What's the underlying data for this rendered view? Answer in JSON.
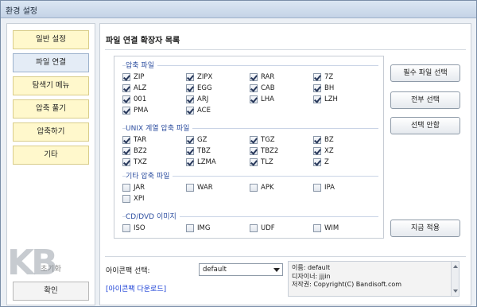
{
  "window": {
    "title": "환경 설정"
  },
  "sidebar": {
    "items": [
      {
        "label": "일반 설정"
      },
      {
        "label": "파일 연결"
      },
      {
        "label": "탐색기 메뉴"
      },
      {
        "label": "압축 풀기"
      },
      {
        "label": "압축하기"
      },
      {
        "label": "기타"
      }
    ],
    "reset_label": "초기화",
    "ok_label": "확인"
  },
  "main": {
    "title": "파일 연결 확장자 목록",
    "groups": [
      {
        "label": "압축 파일",
        "items": [
          {
            "label": "ZIP",
            "checked": true
          },
          {
            "label": "ZIPX",
            "checked": true
          },
          {
            "label": "RAR",
            "checked": true
          },
          {
            "label": "7Z",
            "checked": true
          },
          {
            "label": "ALZ",
            "checked": true
          },
          {
            "label": "EGG",
            "checked": true
          },
          {
            "label": "CAB",
            "checked": true
          },
          {
            "label": "BH",
            "checked": true
          },
          {
            "label": "001",
            "checked": true
          },
          {
            "label": "ARJ",
            "checked": true
          },
          {
            "label": "LHA",
            "checked": true
          },
          {
            "label": "LZH",
            "checked": true
          },
          {
            "label": "PMA",
            "checked": true
          },
          {
            "label": "ACE",
            "checked": true
          }
        ]
      },
      {
        "label": "UNIX 계열 압축 파일",
        "items": [
          {
            "label": "TAR",
            "checked": true
          },
          {
            "label": "GZ",
            "checked": true
          },
          {
            "label": "TGZ",
            "checked": true
          },
          {
            "label": "BZ",
            "checked": true
          },
          {
            "label": "BZ2",
            "checked": true
          },
          {
            "label": "TBZ",
            "checked": true
          },
          {
            "label": "TBZ2",
            "checked": true
          },
          {
            "label": "XZ",
            "checked": true
          },
          {
            "label": "TXZ",
            "checked": true
          },
          {
            "label": "LZMA",
            "checked": true
          },
          {
            "label": "TLZ",
            "checked": true
          },
          {
            "label": "Z",
            "checked": true
          }
        ]
      },
      {
        "label": "기타 압축 파일",
        "items": [
          {
            "label": "JAR",
            "checked": false
          },
          {
            "label": "WAR",
            "checked": false
          },
          {
            "label": "APK",
            "checked": false
          },
          {
            "label": "IPA",
            "checked": false
          },
          {
            "label": "XPI",
            "checked": false
          }
        ]
      },
      {
        "label": "CD/DVD 이미지",
        "items": [
          {
            "label": "ISO",
            "checked": false
          },
          {
            "label": "IMG",
            "checked": false
          },
          {
            "label": "UDF",
            "checked": false
          },
          {
            "label": "WIM",
            "checked": false
          }
        ]
      }
    ],
    "buttons": {
      "select_required": "필수 파일 선택",
      "select_all": "전부 선택",
      "select_none": "선택 안함",
      "apply_now": "지금 적용"
    },
    "iconpack": {
      "label": "아이콘팩 선택:",
      "selected": "default",
      "download_link": "[아이콘팩 다운로드]",
      "info": {
        "name": "이름: default",
        "designer": "디자이너: jjjin",
        "copyright": "저작권: Copyright(C) Bandisoft.com"
      }
    }
  },
  "watermark": "KB"
}
